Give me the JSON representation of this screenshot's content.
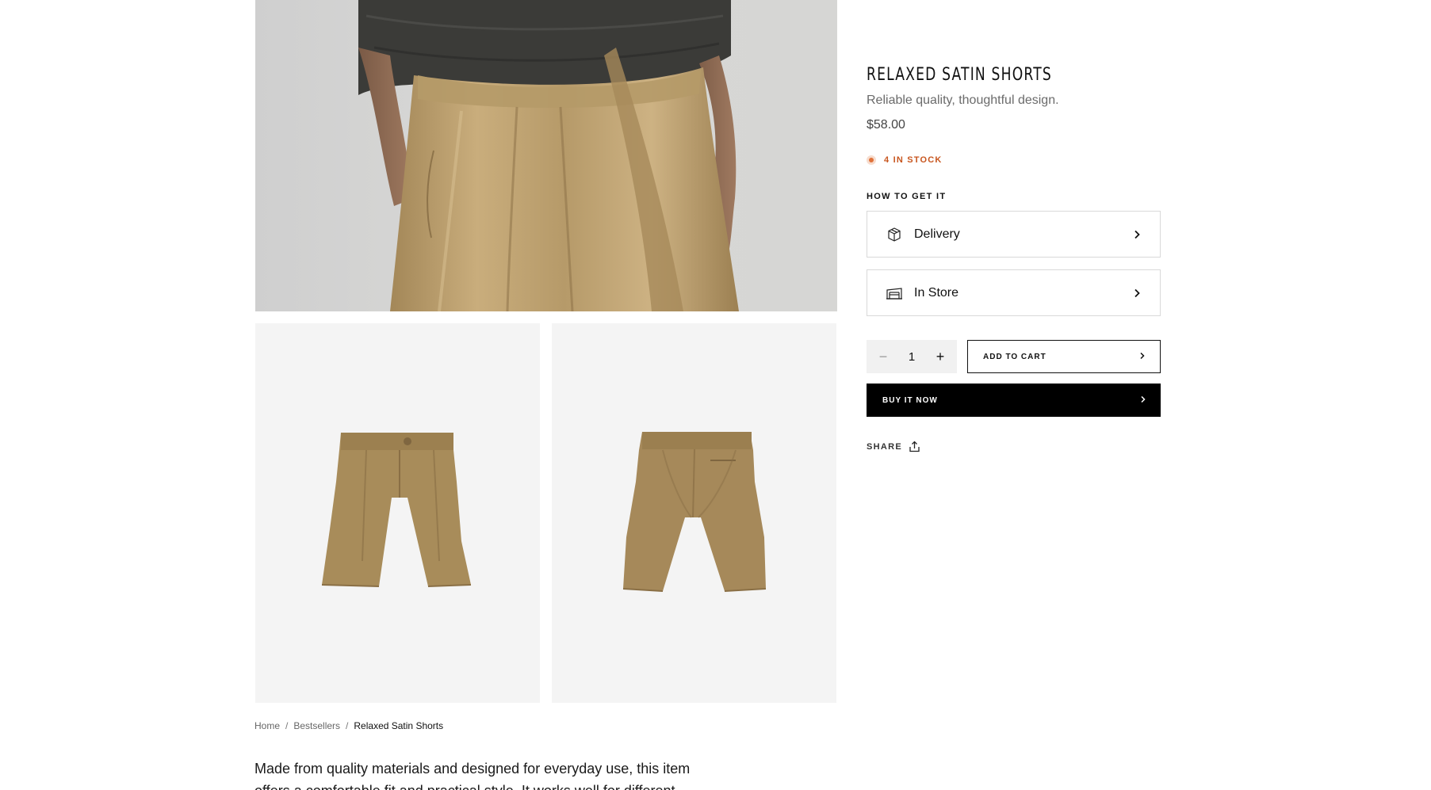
{
  "product": {
    "title": "RELAXED SATIN SHORTS",
    "subtitle": "Reliable quality, thoughtful design.",
    "price": "$58.00",
    "stock_text": "4 IN STOCK"
  },
  "fulfillment": {
    "label": "HOW TO GET IT",
    "options": [
      {
        "label": "Delivery",
        "icon": "package-box-icon"
      },
      {
        "label": "In Store",
        "icon": "store-icon"
      }
    ]
  },
  "purchase": {
    "quantity": "1",
    "minus_symbol": "−",
    "plus_symbol": "+",
    "add_to_cart_label": "ADD TO CART",
    "buy_now_label": "BUY IT NOW"
  },
  "share": {
    "label": "SHARE",
    "icon": "share-upload-icon"
  },
  "breadcrumb": {
    "items": [
      "Home",
      "Bestsellers"
    ],
    "separator": "/",
    "current": "Relaxed Satin Shorts"
  },
  "description": "Made from quality materials and designed for everyday use, this item offers a comfortable fit and practical style. It works well for different",
  "colors": {
    "stock_accent": "#e0723a",
    "stock_text": "#c8561f",
    "buy_now_bg": "#000000",
    "fabric": "#a88c5a"
  }
}
